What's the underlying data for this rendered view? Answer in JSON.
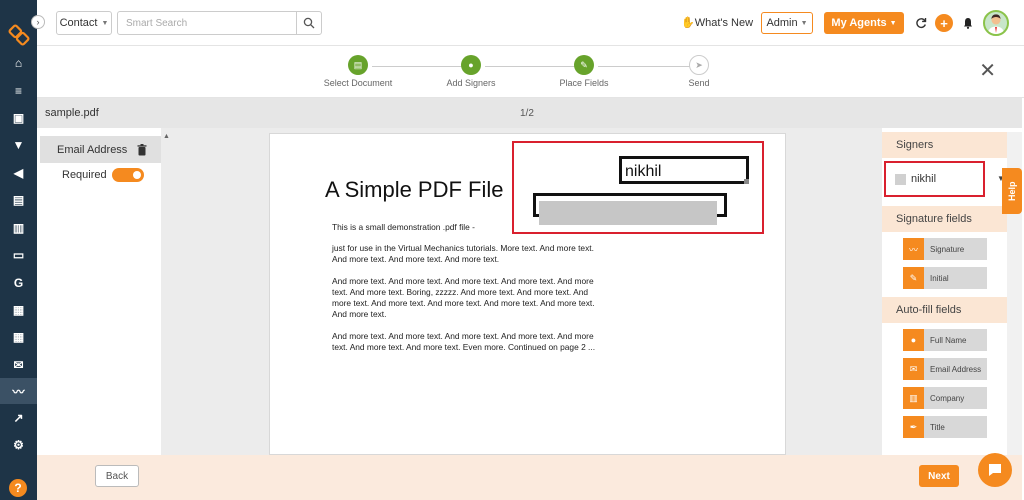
{
  "colors": {
    "accent": "#f58a1f",
    "rail": "#1e3447",
    "step_done": "#67a32b",
    "highlight": "#d9202e"
  },
  "sidebar": {
    "items": [
      {
        "name": "home-icon",
        "glyph": "⌂"
      },
      {
        "name": "list-icon",
        "glyph": "≡"
      },
      {
        "name": "contacts-icon",
        "glyph": "▣"
      },
      {
        "name": "filter-icon",
        "glyph": "▼"
      },
      {
        "name": "megaphone-icon",
        "glyph": "◀"
      },
      {
        "name": "document-icon",
        "glyph": "▤"
      },
      {
        "name": "chart-bar-icon",
        "glyph": "▥"
      },
      {
        "name": "folder-icon",
        "glyph": "▭"
      },
      {
        "name": "google-icon",
        "glyph": "G"
      },
      {
        "name": "calculator-icon",
        "glyph": "▦"
      },
      {
        "name": "calendar-icon",
        "glyph": "▦"
      },
      {
        "name": "mail-icon",
        "glyph": "✉"
      },
      {
        "name": "signature-icon",
        "glyph": "〰"
      },
      {
        "name": "analytics-icon",
        "glyph": "↗"
      },
      {
        "name": "settings-icon",
        "glyph": "⚙"
      }
    ],
    "help": "?"
  },
  "header": {
    "contact_label": "Contact",
    "search_placeholder": "Smart Search",
    "whats_new": "What's New",
    "admin_label": "Admin",
    "agents_label": "My Agents"
  },
  "stepper": {
    "steps": [
      {
        "label": "Select Document",
        "done": true,
        "glyph": "▤"
      },
      {
        "label": "Add Signers",
        "done": true,
        "glyph": "●"
      },
      {
        "label": "Place Fields",
        "done": true,
        "glyph": "✎"
      },
      {
        "label": "Send",
        "done": false,
        "glyph": "➤"
      }
    ]
  },
  "filebar": {
    "filename": "sample.pdf",
    "page": "1/2"
  },
  "field_panel": {
    "field_name": "Email Address",
    "required_label": "Required",
    "required": true
  },
  "pdf": {
    "title": "A Simple PDF File",
    "paragraphs": [
      "This is a small demonstration .pdf file -",
      "just for use in the Virtual Mechanics tutorials. More text. And more text. And more text. And more text. And more text.",
      "And more text. And more text. And more text. And more text. And more text. And more text. Boring, zzzzz. And more text. And more text. And more text. And more text. And more text. And more text. And more text. And more text.",
      "And more text. And more text. And more text. And more text. And more text. And more text. And more text. Even more. Continued on page 2 ..."
    ],
    "signature_value": "nikhil"
  },
  "right_panel": {
    "signers_header": "Signers",
    "signer_name": "nikhil",
    "signature_header": "Signature fields",
    "signature_fields": [
      "Signature",
      "Initial"
    ],
    "autofill_header": "Auto-fill fields",
    "autofill_fields": [
      "Full Name",
      "Email Address",
      "Company",
      "Title"
    ],
    "help_tab": "Help"
  },
  "footer": {
    "back_label": "Back",
    "next_label": "Next"
  }
}
